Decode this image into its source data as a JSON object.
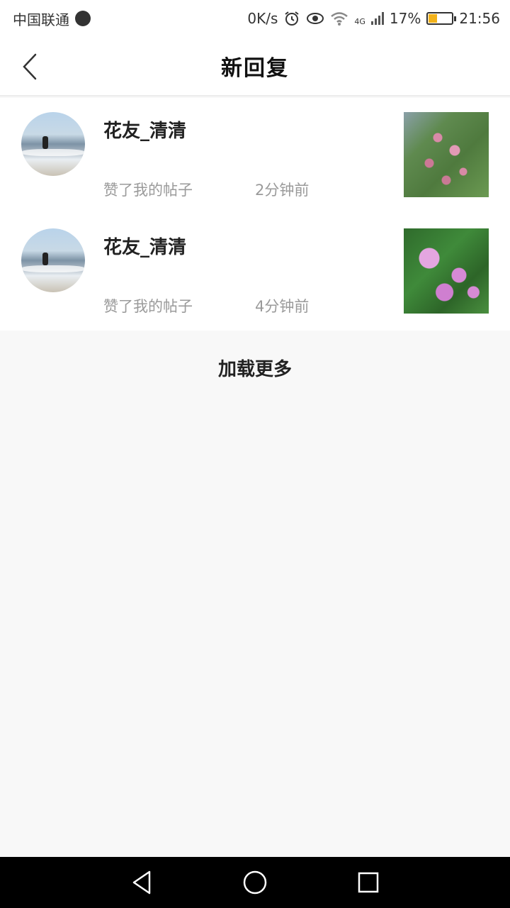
{
  "status_bar": {
    "carrier": "中国联通",
    "speed": "0K/s",
    "network": "4G",
    "battery": "17%",
    "time": "21:56"
  },
  "header": {
    "title": "新回复"
  },
  "replies": [
    {
      "username": "花友_清清",
      "action": "赞了我的帖子",
      "time": "2分钟前"
    },
    {
      "username": "花友_清清",
      "action": "赞了我的帖子",
      "time": "4分钟前"
    }
  ],
  "load_more": "加载更多"
}
